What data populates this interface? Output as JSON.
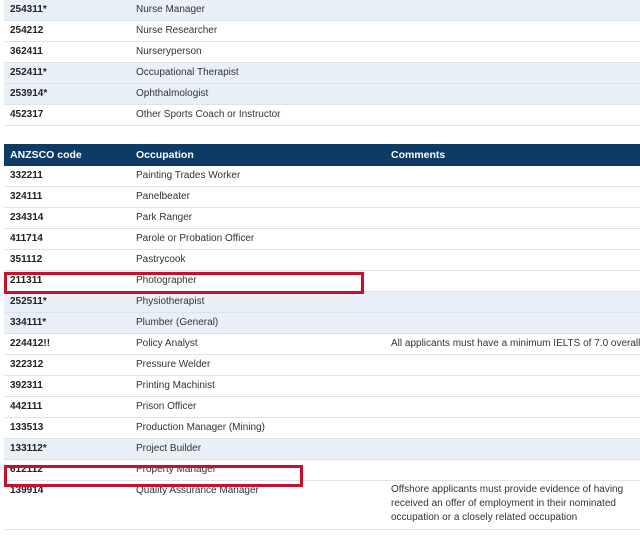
{
  "table_top": {
    "rows": [
      {
        "code": "254311*",
        "occupation": "Nurse Manager",
        "comments": "",
        "shaded": true
      },
      {
        "code": "254212",
        "occupation": "Nurse Researcher",
        "comments": "",
        "shaded": false
      },
      {
        "code": "362411",
        "occupation": "Nurseryperson",
        "comments": "",
        "shaded": false
      },
      {
        "code": "252411*",
        "occupation": "Occupational Therapist",
        "comments": "",
        "shaded": true
      },
      {
        "code": "253914*",
        "occupation": "Ophthalmologist",
        "comments": "",
        "shaded": true
      },
      {
        "code": "452317",
        "occupation": "Other Sports Coach or Instructor",
        "comments": "",
        "shaded": false
      }
    ]
  },
  "table_main": {
    "headers": {
      "code": "ANZSCO code",
      "occupation": "Occupation",
      "comments": "Comments"
    },
    "rows": [
      {
        "code": "332211",
        "occupation": "Painting Trades Worker",
        "comments": "",
        "shaded": false
      },
      {
        "code": "324111",
        "occupation": "Panelbeater",
        "comments": "",
        "shaded": false
      },
      {
        "code": "234314",
        "occupation": "Park Ranger",
        "comments": "",
        "shaded": false
      },
      {
        "code": "411714",
        "occupation": "Parole or Probation Officer",
        "comments": "",
        "shaded": false
      },
      {
        "code": "351112",
        "occupation": "Pastrycook",
        "comments": "",
        "shaded": false
      },
      {
        "code": "211311",
        "occupation": "Photographer",
        "comments": "",
        "shaded": false
      },
      {
        "code": "252511*",
        "occupation": "Physiotherapist",
        "comments": "",
        "shaded": true
      },
      {
        "code": "334111*",
        "occupation": "Plumber (General)",
        "comments": "",
        "shaded": true
      },
      {
        "code": "224412!!",
        "occupation": "Policy Analyst",
        "comments": "All applicants must have a minimum IELTS of 7.0 overall",
        "shaded": false
      },
      {
        "code": "322312",
        "occupation": "Pressure Welder",
        "comments": "",
        "shaded": false
      },
      {
        "code": "392311",
        "occupation": "Printing Machinist",
        "comments": "",
        "shaded": false
      },
      {
        "code": "442111",
        "occupation": "Prison Officer",
        "comments": "",
        "shaded": false
      },
      {
        "code": "133513",
        "occupation": "Production Manager (Mining)",
        "comments": "",
        "shaded": false
      },
      {
        "code": "133112*",
        "occupation": "Project Builder",
        "comments": "",
        "shaded": true
      },
      {
        "code": "612112",
        "occupation": "Property Manager",
        "comments": "",
        "shaded": false
      },
      {
        "code": "139914",
        "occupation": "Quality Assurance Manager",
        "comments": "Offshore applicants must provide evidence of having received an offer of employment in their nominated occupation or a closely related occupation",
        "shaded": false
      }
    ]
  },
  "highlighted_codes": [
    "211311",
    "612112"
  ],
  "colors": {
    "header_bg": "#0e3a66",
    "row_shade": "#e9f0f8",
    "highlight_border": "#c8102e"
  }
}
